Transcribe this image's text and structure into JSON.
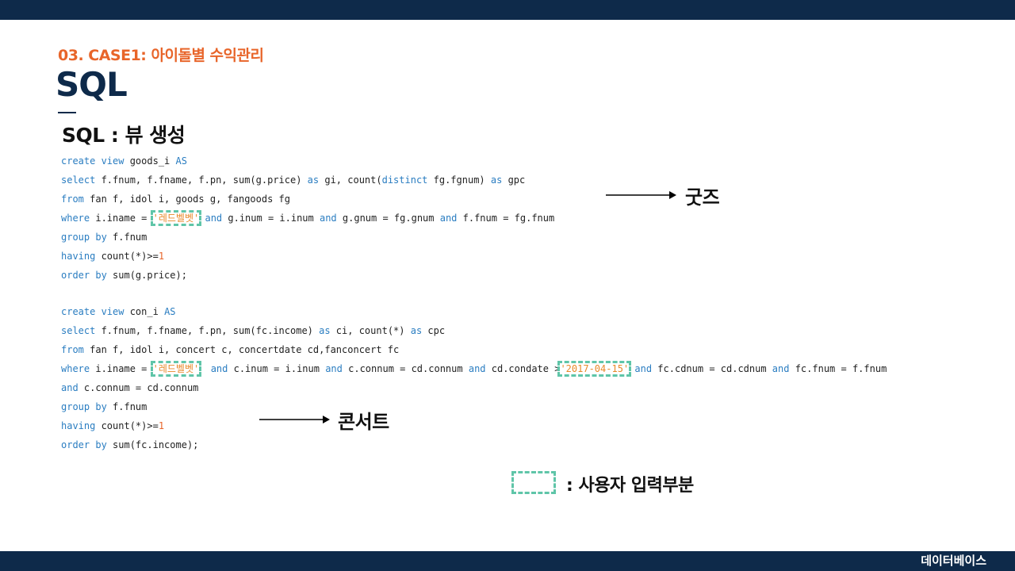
{
  "header": {
    "section_label": "03. CASE1: 아이돌별 수익관리",
    "title": "SQL",
    "subtitle": "SQL : 뷰 생성"
  },
  "code_goods": {
    "l1_kw1": "create view",
    "l1_txt": " goods_i ",
    "l1_kw2": "AS",
    "l2_kw1": "select",
    "l2_txt1": " f.fnum, f.fname, f.pn, sum(g.price) ",
    "l2_kw2": "as",
    "l2_txt2": " gi, count(",
    "l2_kw3": "distinct",
    "l2_txt3": " fg.fgnum) ",
    "l2_kw4": "as",
    "l2_txt4": " gpc",
    "l3_kw1": "from",
    "l3_txt": " fan f, idol i, goods g, fangoods fg",
    "l4_kw1": "where",
    "l4_txt1": " i.iname = ",
    "l4_str": "'레드벨벳'",
    "l4_txt2": " ",
    "l4_kw2": "and",
    "l4_txt3": " g.inum = i.inum ",
    "l4_kw3": "and",
    "l4_txt4": " g.gnum = fg.gnum ",
    "l4_kw4": "and",
    "l4_txt5": " f.fnum = fg.fnum",
    "l5_kw1": "group by",
    "l5_txt": " f.fnum",
    "l6_kw1": "having",
    "l6_txt": " count(*)>=",
    "l6_num": "1",
    "l7_kw1": "order by",
    "l7_txt": " sum(g.price);"
  },
  "code_concert": {
    "l1_kw1": "create view",
    "l1_txt": " con_i ",
    "l1_kw2": "AS",
    "l2_kw1": "select",
    "l2_txt1": " f.fnum, f.fname, f.pn, sum(fc.income) ",
    "l2_kw2": "as",
    "l2_txt2": " ci, count(*) ",
    "l2_kw3": "as",
    "l2_txt3": " cpc",
    "l3_kw1": "from",
    "l3_txt": " fan f, idol i, concert c, concertdate cd,fanconcert fc",
    "l4_kw1": "where",
    "l4_txt1": " i.iname = ",
    "l4_str": "'레드벨벳'",
    "l4_txt2": "  ",
    "l4_kw2": "and",
    "l4_txt3": " c.inum = i.inum ",
    "l4_kw3": "and",
    "l4_txt4": " c.connum = cd.connum ",
    "l4_kw4": "and",
    "l4_txt5": " cd.condate >",
    "l4_str2": "'2017-04-15'",
    "l4_txt6": " ",
    "l4_kw5": "and",
    "l4_txt7": " fc.cdnum = cd.cdnum ",
    "l4_kw6": "and",
    "l4_txt8": " fc.fnum = f.fnum",
    "l5_kw1": "and",
    "l5_txt": " c.connum = cd.connum",
    "l6_kw1": "group by",
    "l6_txt": " f.fnum",
    "l7_kw1": "having",
    "l7_txt": " count(*)>=",
    "l7_num": "1",
    "l8_kw1": "order by",
    "l8_txt": " sum(fc.income);"
  },
  "annotations": {
    "goods": "굿즈",
    "concert": "콘서트"
  },
  "legend": {
    "label": ": 사용자 입력부분"
  },
  "footer": {
    "label": "데이터베이스"
  },
  "colors": {
    "navy": "#0e2a4a",
    "accent_orange": "#e8652a",
    "keyword_blue": "#2a7dc1",
    "highlight_green": "#5fc5a8"
  }
}
